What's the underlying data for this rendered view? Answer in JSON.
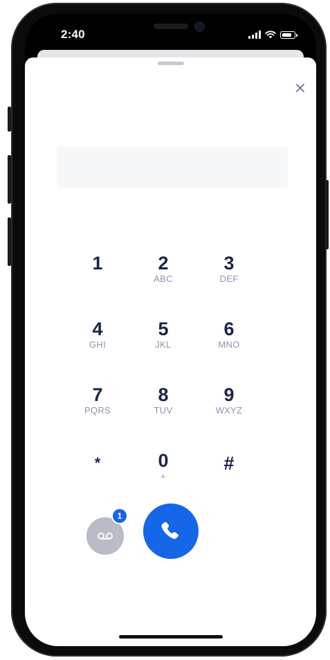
{
  "status_bar": {
    "time": "2:40",
    "icons": [
      "signal-icon",
      "wifi-icon",
      "battery-icon"
    ]
  },
  "dialer": {
    "close_icon": "close-icon",
    "number_value": "",
    "keys": [
      {
        "digit": "1",
        "letters": ""
      },
      {
        "digit": "2",
        "letters": "ABC"
      },
      {
        "digit": "3",
        "letters": "DEF"
      },
      {
        "digit": "4",
        "letters": "GHI"
      },
      {
        "digit": "5",
        "letters": "JKL"
      },
      {
        "digit": "6",
        "letters": "MNO"
      },
      {
        "digit": "7",
        "letters": "PQRS"
      },
      {
        "digit": "8",
        "letters": "TUV"
      },
      {
        "digit": "9",
        "letters": "WXYZ"
      },
      {
        "digit": "*",
        "letters": ""
      },
      {
        "digit": "0",
        "letters": "+"
      },
      {
        "digit": "#",
        "letters": ""
      }
    ],
    "voicemail": {
      "icon": "voicemail-icon",
      "badge_count": "1"
    },
    "call": {
      "icon": "phone-icon"
    }
  },
  "colors": {
    "accent": "#1566e8",
    "digit_text": "#1d2447",
    "letters_text": "#8b94b3",
    "voicemail_bg": "#b9bcc6",
    "input_bg": "#f6f7f9"
  }
}
